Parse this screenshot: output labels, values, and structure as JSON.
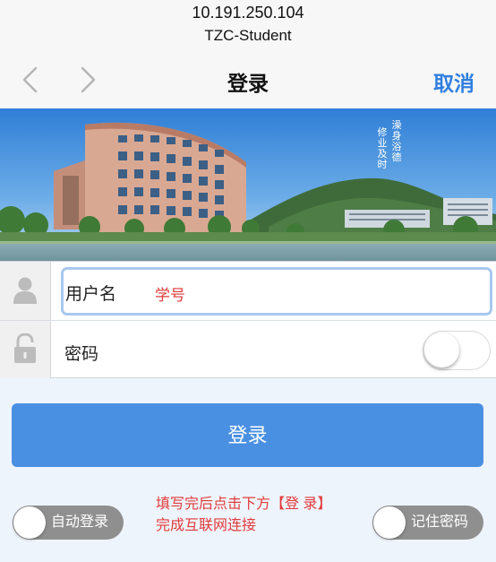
{
  "header": {
    "address": "10.191.250.104",
    "network": "TZC-Student",
    "title": "登录",
    "cancel_label": "取消"
  },
  "banner": {
    "slogan_col1": "澡身浴德",
    "slogan_col2": "修业及时"
  },
  "form": {
    "username_label": "用户名",
    "username_hint": "学号",
    "password_label": "密码"
  },
  "login_button": "登录",
  "footer": {
    "auto_login_label": "自动登录",
    "remember_password_label": "记住密码",
    "instruction_line1": "填写完后点击下方【登 录】",
    "instruction_line2": "完成互联网连接"
  },
  "colors": {
    "accent": "#4a90e2",
    "link": "#2f7fe0",
    "hint": "#e23b3b"
  },
  "icons": [
    "chevron-left-icon",
    "chevron-right-icon",
    "user-icon",
    "lock-icon"
  ]
}
